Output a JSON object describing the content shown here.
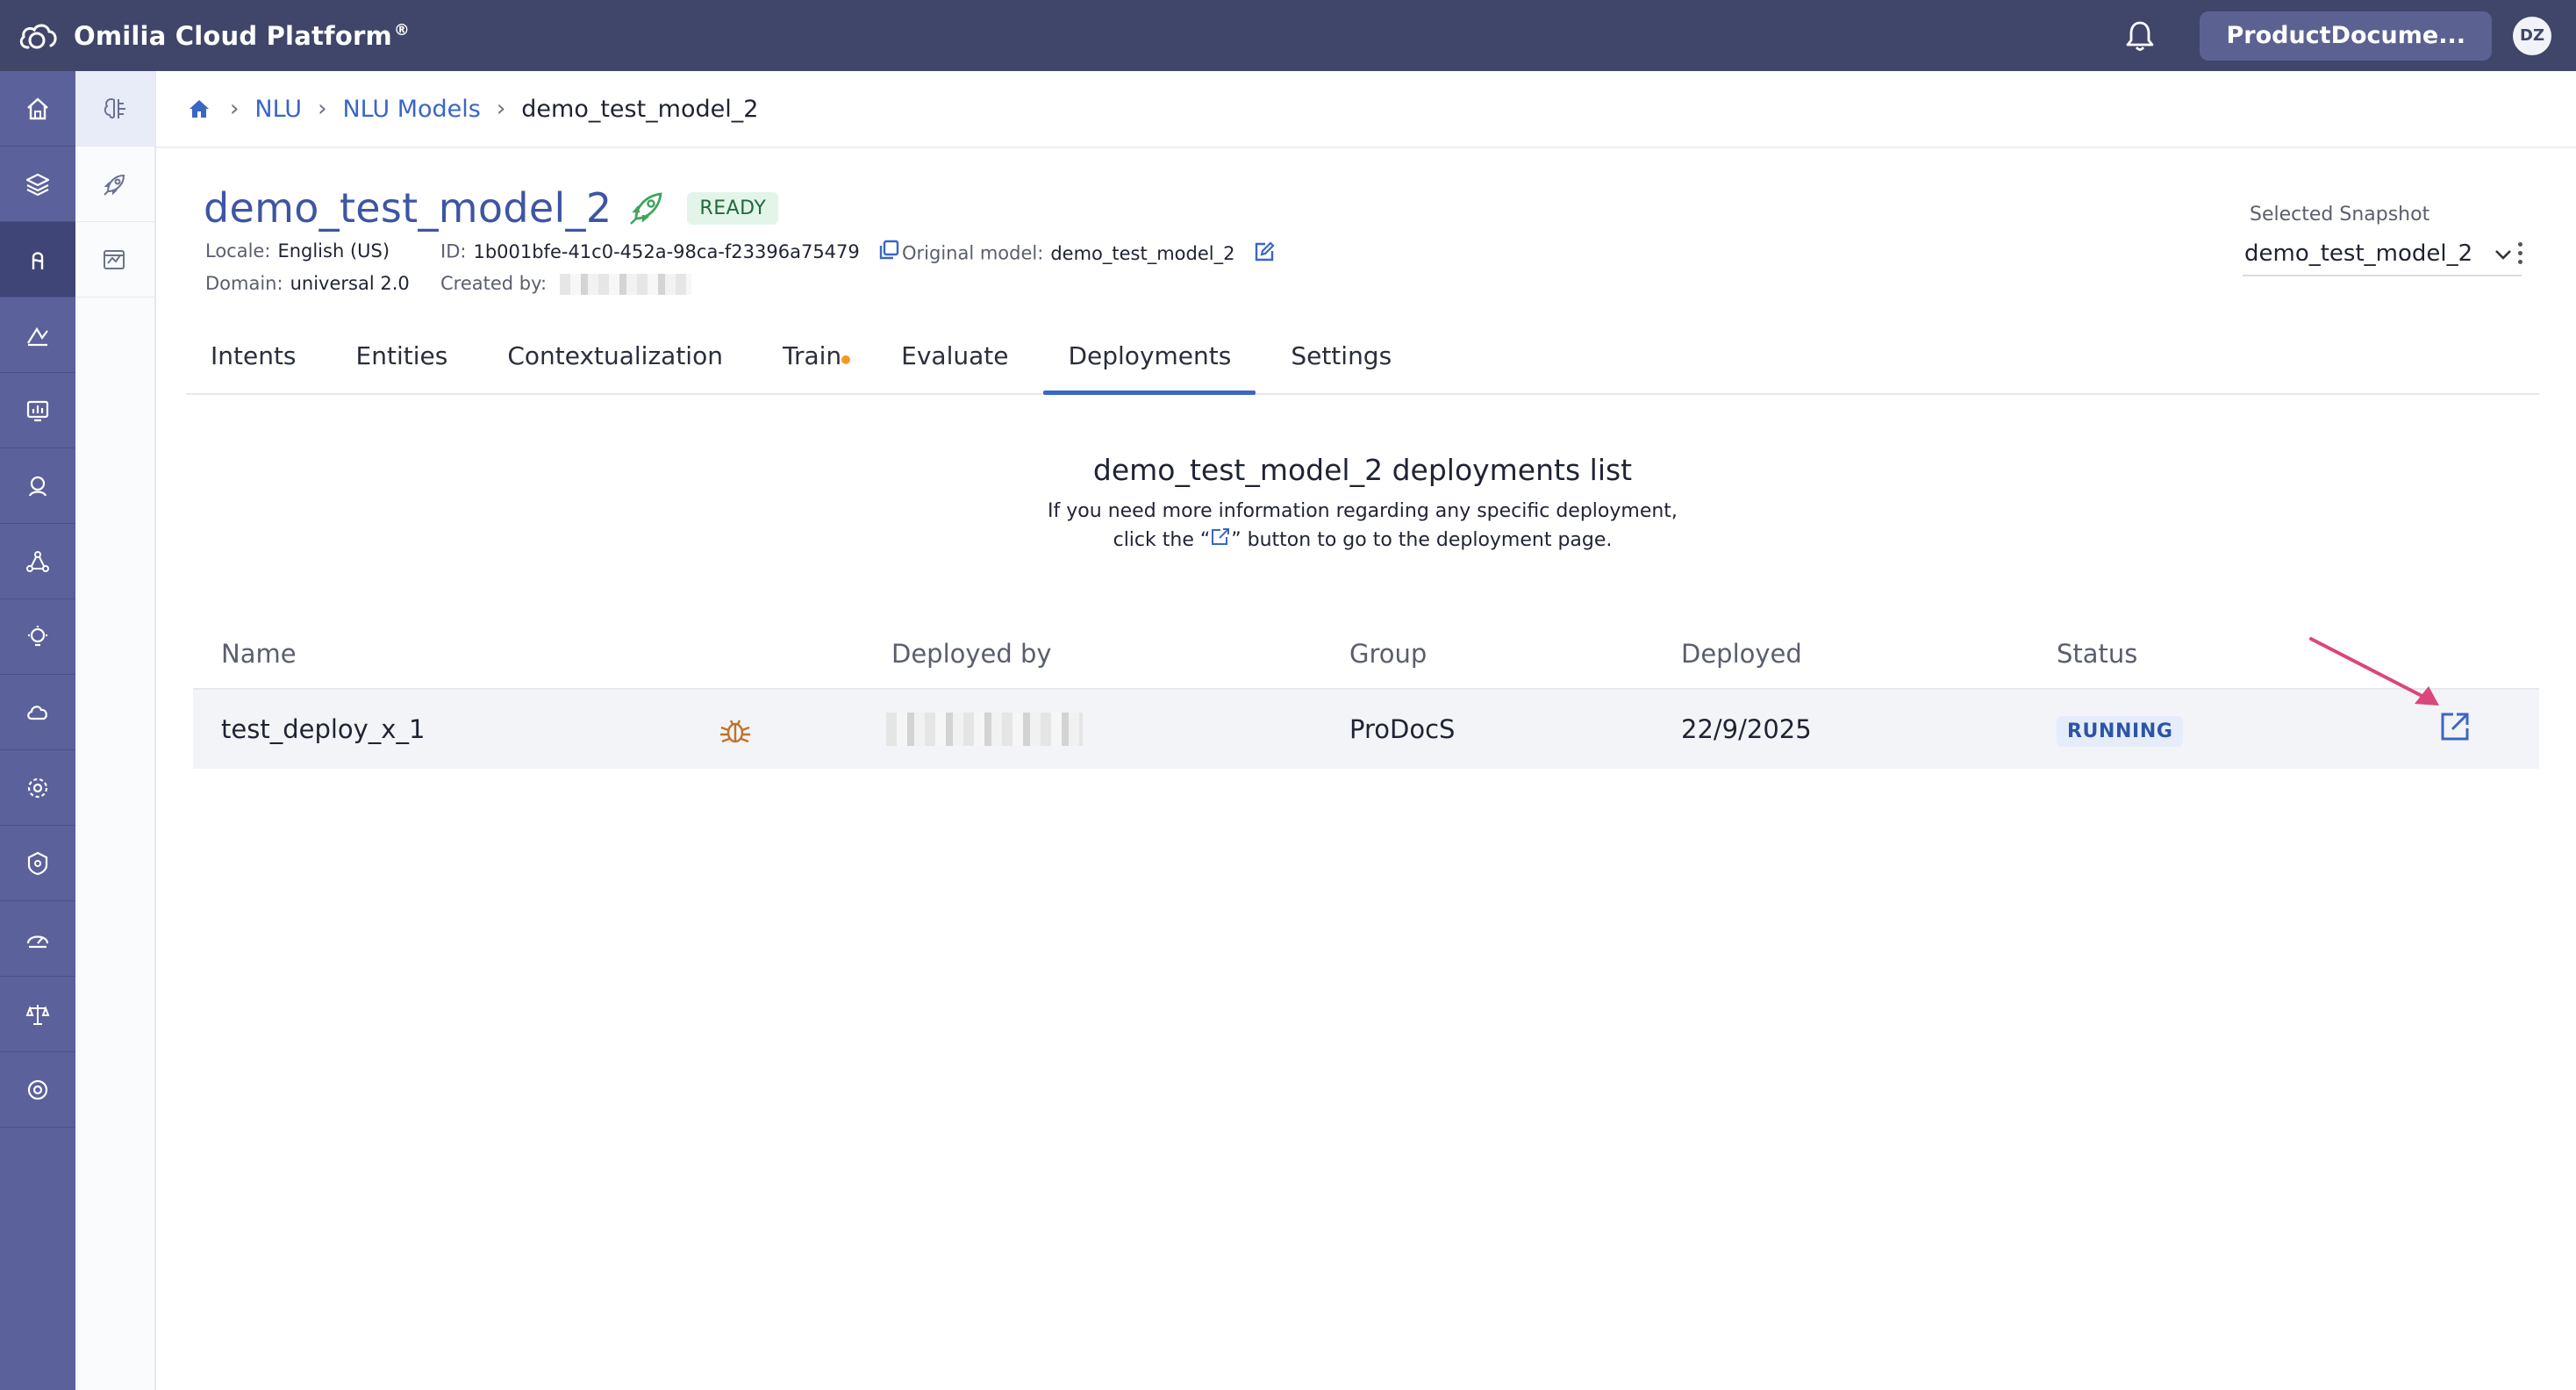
{
  "topbar": {
    "app_name": "Omilia Cloud Platform",
    "reg_mark": "®",
    "org_button": "ProductDocume...",
    "avatar_initials": "DZ"
  },
  "nav_rail": {
    "icons": [
      "home-icon",
      "layers-icon",
      "nlu-icon",
      "analytics-icon",
      "monitor-icon",
      "agent-icon",
      "network-icon",
      "insights-icon",
      "cloud-icon",
      "settings-icon",
      "security-icon",
      "speed-icon",
      "legal-icon",
      "support-icon"
    ],
    "active_index": 2
  },
  "sub_rail": {
    "icons": [
      "brain-icon",
      "rocket-icon",
      "chart-edit-icon"
    ],
    "active_index": 0
  },
  "breadcrumb": {
    "items": [
      "NLU",
      "NLU Models"
    ],
    "current": "demo_test_model_2"
  },
  "model": {
    "name": "demo_test_model_2",
    "status": "READY",
    "locale_label": "Locale:",
    "locale_value": "English (US)",
    "domain_label": "Domain:",
    "domain_value": "universal 2.0",
    "id_label": "ID:",
    "id_value": "1b001bfe-41c0-452a-98ca-f23396a75479",
    "created_by_label": "Created by:",
    "original_model_label": "Original model:",
    "original_model_value": "demo_test_model_2"
  },
  "snapshot": {
    "label": "Selected Snapshot",
    "value": "demo_test_model_2"
  },
  "tabs": [
    "Intents",
    "Entities",
    "Contextualization",
    "Train",
    "Evaluate",
    "Deployments",
    "Settings"
  ],
  "active_tab": "Deployments",
  "deployments": {
    "title": "demo_test_model_2 deployments list",
    "desc_line1": "If you need more information regarding any specific deployment,",
    "desc_pre": "click the “",
    "desc_post": "” button to go to the deployment page.",
    "columns": {
      "name": "Name",
      "deployed_by": "Deployed by",
      "group": "Group",
      "deployed": "Deployed",
      "status": "Status"
    },
    "rows": [
      {
        "name": "test_deploy_x_1",
        "group": "ProDocS",
        "deployed": "22/9/2025",
        "status": "RUNNING"
      }
    ]
  },
  "colors": {
    "topbar": "#3f4669",
    "rail": "#5b619a",
    "accent": "#3a66c4",
    "title": "#3e55a3",
    "ready_bg": "#e3f5e8",
    "running_bg": "#e6edfa",
    "arrow": "#d9477d"
  }
}
